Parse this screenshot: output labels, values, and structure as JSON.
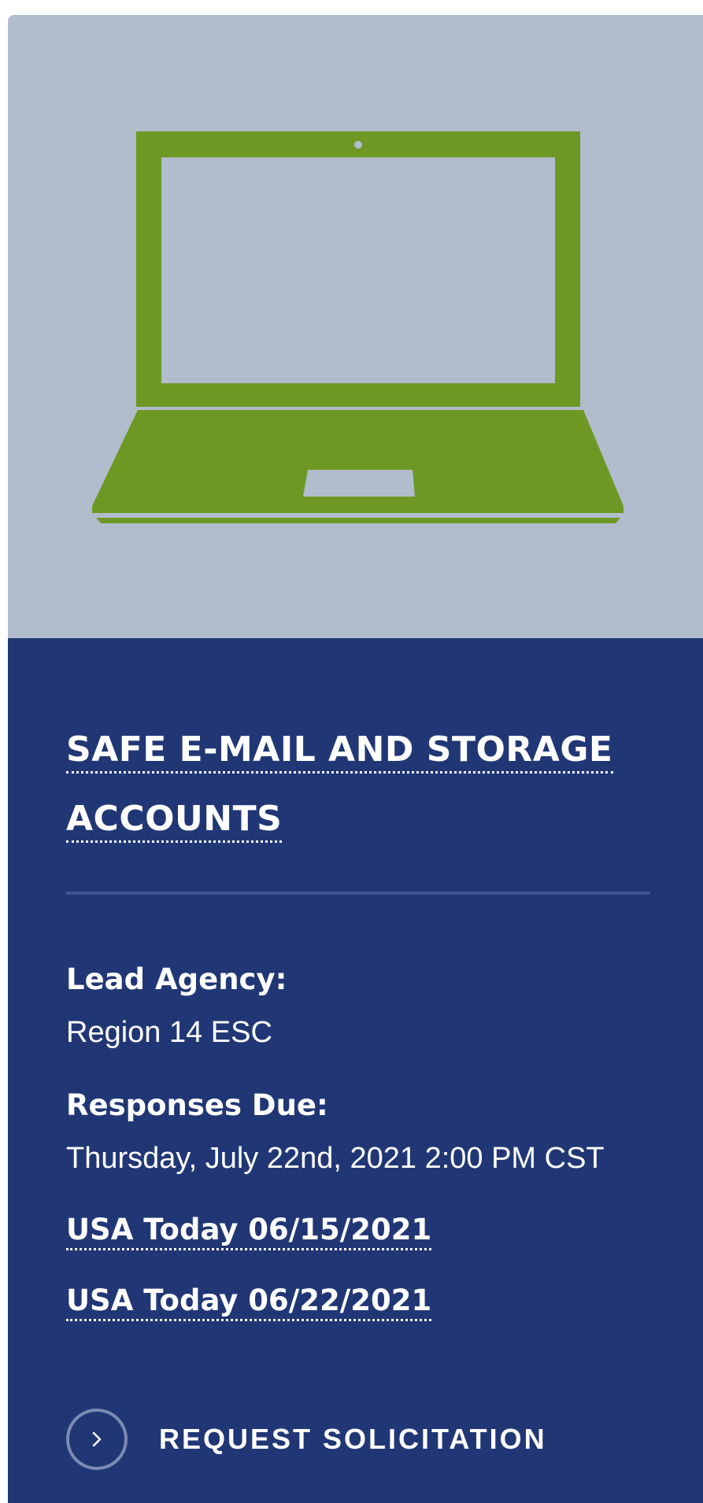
{
  "card": {
    "image": {
      "icon": "laptop-icon",
      "background_color": "#b1bdcd",
      "icon_color": "#6e9824"
    },
    "title_line_1": "SAFE E-MAIL AND STORAGE",
    "title_line_2": "ACCOUNTS",
    "details": {
      "lead_agency_label": "Lead Agency:",
      "lead_agency_value": "Region 14 ESC",
      "responses_due_label": "Responses Due:",
      "responses_due_value": "Thursday, July 22nd, 2021 2:00 PM CST"
    },
    "links": [
      "USA Today 06/15/2021",
      "USA Today 06/22/2021"
    ],
    "cta": {
      "icon": "chevron-right-icon",
      "label": "REQUEST SOLICITATION"
    },
    "body_color": "#213775"
  }
}
